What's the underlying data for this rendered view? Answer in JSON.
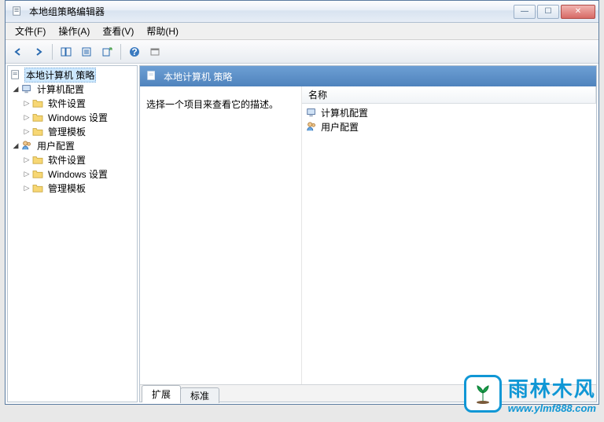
{
  "window": {
    "title": "本地组策略编辑器"
  },
  "menu": {
    "file": "文件(F)",
    "action": "操作(A)",
    "view": "查看(V)",
    "help": "帮助(H)"
  },
  "tree": {
    "root": "本地计算机 策略",
    "computer": "计算机配置",
    "user": "用户配置",
    "software": "软件设置",
    "windows": "Windows 设置",
    "templates": "管理模板"
  },
  "right": {
    "header": "本地计算机 策略",
    "prompt": "选择一个项目来查看它的描述。",
    "col_name": "名称",
    "row_computer": "计算机配置",
    "row_user": "用户配置"
  },
  "tabs": {
    "extended": "扩展",
    "standard": "标准"
  },
  "watermark": {
    "line1": "雨林木风",
    "line2": "www.ylmf888.com"
  }
}
